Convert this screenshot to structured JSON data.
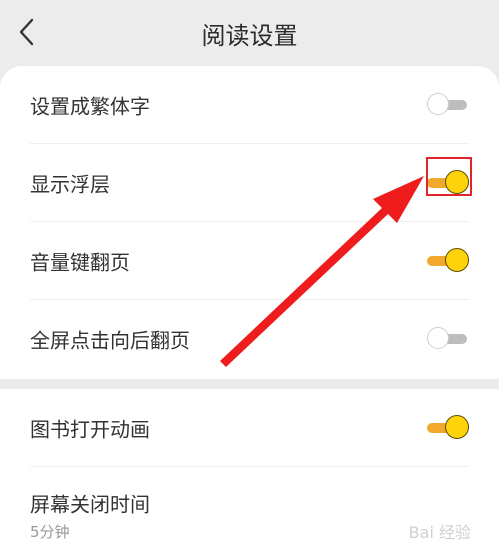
{
  "header": {
    "title": "阅读设置"
  },
  "settings": [
    {
      "label": "设置成繁体字",
      "enabled": false
    },
    {
      "label": "显示浮层",
      "enabled": true
    },
    {
      "label": "音量键翻页",
      "enabled": true
    },
    {
      "label": "全屏点击向后翻页",
      "enabled": false
    },
    {
      "label": "图书打开动画",
      "enabled": true
    },
    {
      "label": "屏幕关闭时间",
      "value": "5分钟"
    }
  ],
  "watermark": "Bai 经验",
  "colors": {
    "toggle_on_track": "#f0a92c",
    "toggle_on_knob": "#ffd30a",
    "toggle_off_track": "#bdbdbd",
    "annotation": "#e0262a"
  }
}
